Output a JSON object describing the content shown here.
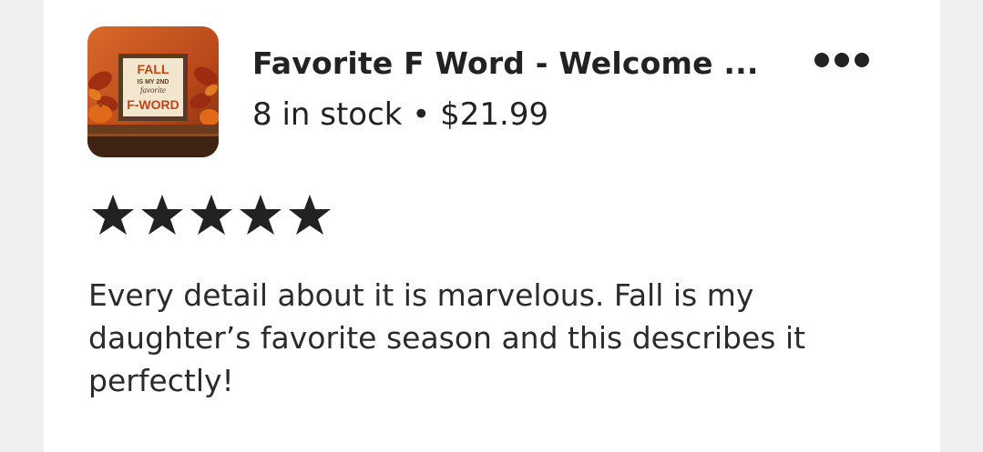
{
  "listing": {
    "title": "Favorite F Word - Welcome ...",
    "subtitle": "8 in stock • $21.99",
    "thumbnail": {
      "sign_text": [
        "FALL",
        "IS MY 2ND",
        "favorite",
        "F-WORD"
      ],
      "colors": {
        "background": "#c2521d",
        "frame": "#5a3a22",
        "sign": "#f3e6cf",
        "text": "#c2431a",
        "shelf": "#6b3b1c"
      }
    },
    "menu_icon": "more-horizontal-icon"
  },
  "review": {
    "rating": 5,
    "rating_max": 5,
    "star_icon": "star-icon",
    "star_color": "#222222",
    "text": "Every detail about it is marvelous. Fall is my daughter’s favorite season and this describes it perfectly!"
  }
}
